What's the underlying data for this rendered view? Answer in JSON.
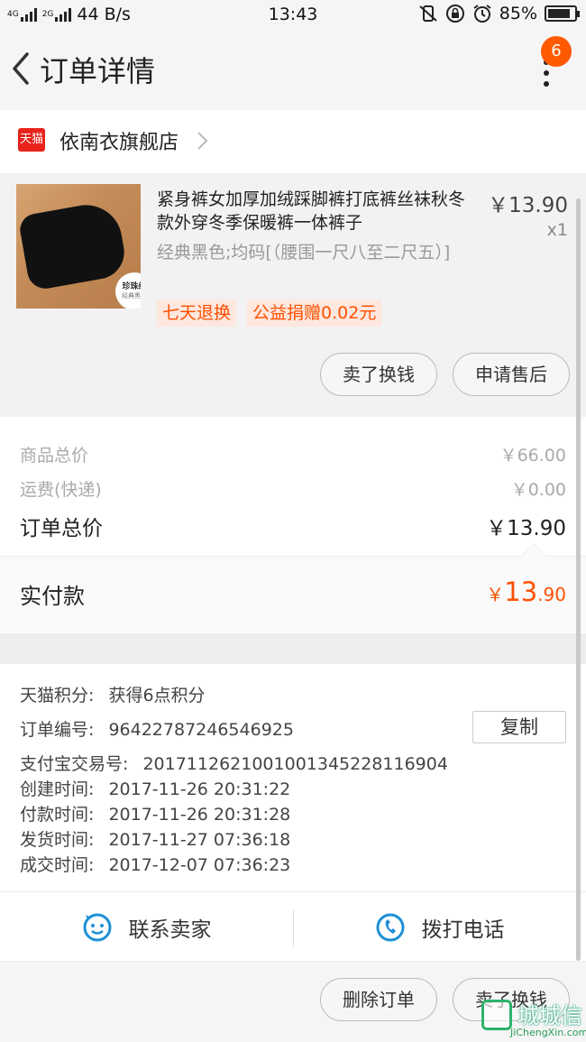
{
  "status_bar": {
    "network_speed": "44 B/s",
    "time": "13:43",
    "battery": "85%",
    "battery_level": 0.85,
    "net_labels": [
      "4G",
      "2G"
    ]
  },
  "header": {
    "title": "订单详情",
    "badge_count": "6",
    "icons": [
      "back-arrow-icon",
      "more-vertical-icon"
    ]
  },
  "shop": {
    "platform_badge": "天猫",
    "name": "依南衣旗舰店"
  },
  "product": {
    "name": "紧身裤女加厚加绒踩脚裤打底裤丝袜秋冬款外穿冬季保暖裤一体裤子",
    "price": "￥13.90",
    "quantity": "x1",
    "sku": "经典黑色;均码[（腰围一尺八至二尺五）]",
    "image_caption_1": "珍珠绒",
    "image_caption_2": "经典黑色",
    "tags": [
      "七天退换",
      "公益捐赠0.02元"
    ],
    "buttons": [
      "卖了换钱",
      "申请售后"
    ]
  },
  "summary": {
    "goods_total_label": "商品总价",
    "goods_total_value": "￥66.00",
    "shipping_label": "运费(快递)",
    "shipping_value": "￥0.00",
    "order_total_label": "订单总价",
    "order_total_value": "￥13.90",
    "paid_label": "实付款",
    "paid_currency": "￥",
    "paid_int": "13",
    "paid_dec": ".90"
  },
  "info": {
    "points_label": "天猫积分:",
    "points_value": "获得6点积分",
    "order_no_label": "订单编号:",
    "order_no_value": "96422787246546925",
    "copy_label": "复制",
    "alipay_label": "支付宝交易号:",
    "alipay_value": "2017112621001001345228116904",
    "created_label": "创建时间:",
    "created_value": "2017-11-26 20:31:22",
    "paid_label": "付款时间:",
    "paid_value": "2017-11-26 20:31:28",
    "shipped_label": "发货时间:",
    "shipped_value": "2017-11-27 07:36:18",
    "done_label": "成交时间:",
    "done_value": "2017-12-07 07:36:23"
  },
  "contact": {
    "seller_label": "联系卖家",
    "phone_label": "拨打电话"
  },
  "bottom": {
    "delete_label": "删除订单",
    "sell_label": "卖了换钱"
  },
  "watermark": {
    "cn": "城城信",
    "en": "JiChengXin.com"
  },
  "colors": {
    "accent": "#ff5000",
    "tmall_red": "#e8231b",
    "icon_blue": "#1e90d6"
  }
}
